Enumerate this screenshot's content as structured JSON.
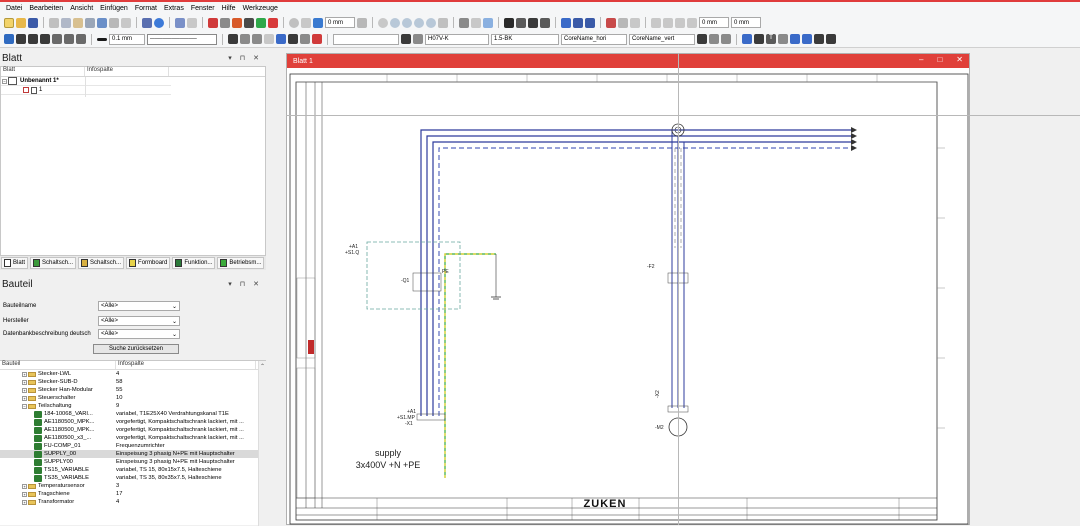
{
  "menu": [
    "Datei",
    "Bearbeiten",
    "Ansicht",
    "Einfügen",
    "Format",
    "Extras",
    "Fenster",
    "Hilfe",
    "Werkzeuge"
  ],
  "toolbar1": {
    "dim1": "0 mm",
    "dim2": "0 mm",
    "dim3": "0 mm"
  },
  "toolbar2": {
    "linewidth": "0.1 mm",
    "wire_type": "H07V-K",
    "wire_cross": "1.5-BK",
    "core_hori": "CoreName_hori",
    "core_vert": "CoreName_vert"
  },
  "blatt_panel": {
    "title": "Blatt",
    "col1": "Blatt",
    "col2": "Infospalte",
    "project": "Unbenannt 1*",
    "sheet": "1"
  },
  "bottom_tabs": [
    "Blatt",
    "Schaltsch...",
    "Schaltsch...",
    "Formboard",
    "Funktion...",
    "Betriebsm..."
  ],
  "bauteil_panel": {
    "title": "Bauteil",
    "fields": [
      {
        "label": "Bauteilname",
        "value": "<Alle>"
      },
      {
        "label": "Hersteller",
        "value": "<Alle>"
      },
      {
        "label": "Datenbankbeschreibung deutsch",
        "value": "<Alle>"
      }
    ],
    "reset_label": "Suche zurücksetzen",
    "col1": "Bauteil",
    "col2": "Infospalte",
    "rows": [
      {
        "name": "Stecker-LWL",
        "info": "4",
        "kind": "folder",
        "exp": "+"
      },
      {
        "name": "Stecker-SUB-D",
        "info": "58",
        "kind": "folder",
        "exp": "+"
      },
      {
        "name": "Stecker Han-Modular",
        "info": "55",
        "kind": "folder",
        "exp": "+"
      },
      {
        "name": "Steuerschalter",
        "info": "10",
        "kind": "folder",
        "exp": "+"
      },
      {
        "name": "Teilschaltung",
        "info": "9",
        "kind": "folder",
        "exp": "-"
      },
      {
        "name": "184-10068_VARI...",
        "info": "variabel, T1E25X40 Verdrahtungskanal T1E",
        "kind": "comp",
        "exp": ""
      },
      {
        "name": "AE1180500_MPK...",
        "info": "vorgefertigt, Kompaktschaltschrank lackiert, mit ...",
        "kind": "comp",
        "exp": ""
      },
      {
        "name": "AE1180500_MPK...",
        "info": "vorgefertigt, Kompaktschaltschrank lackiert, mit ...",
        "kind": "comp",
        "exp": ""
      },
      {
        "name": "AE1180500_x3_...",
        "info": "vorgefertigt, Kompaktschaltschrank lackiert, mit ...",
        "kind": "comp",
        "exp": ""
      },
      {
        "name": "FU-COMP_01",
        "info": "Frequenzumrichter",
        "kind": "comp",
        "exp": ""
      },
      {
        "name": "SUPPLY_00",
        "info": "Einspeisung 3 phasig N+PE mit Hauptschalter",
        "kind": "comp",
        "exp": "",
        "selected": true
      },
      {
        "name": "SUPPLY00",
        "info": "Einspeisung 3 phasig N+PE mit Hauptschalter",
        "kind": "comp",
        "exp": ""
      },
      {
        "name": "TS15_VARIABLE",
        "info": "variabel, TS 15, 80x15x7.5, Halteschiene",
        "kind": "comp",
        "exp": ""
      },
      {
        "name": "TS35_VARIABLE",
        "info": "variabel, TS 35, 80x35x7.5, Halteschiene",
        "kind": "comp",
        "exp": ""
      },
      {
        "name": "Temperatursensor",
        "info": "3",
        "kind": "folder",
        "exp": "+"
      },
      {
        "name": "Tragschiene",
        "info": "17",
        "kind": "folder",
        "exp": "+"
      },
      {
        "name": "Transformator",
        "info": "4",
        "kind": "folder",
        "exp": "+"
      }
    ]
  },
  "document": {
    "title": "Blatt 1",
    "labels": {
      "a1_top": "+A1",
      "s1_top": "+S1.Q",
      "q1": "-Q1",
      "pe": "PE",
      "f2": "-F2",
      "a1_bot": "+A1",
      "s1_bot": "+S1.MP",
      "x1": "-X1",
      "m1": "-M2",
      "x2": "-X2",
      "supply1": "supply",
      "supply2": "3x400V +N +PE",
      "logo": "ZUKEN"
    }
  },
  "colors": {
    "accent_red": "#e0403a",
    "wire_blue": "#2d3b9c",
    "wire_dashed": "#5b6bc0",
    "pe_green": "#3aaa3a",
    "pe_yellow": "#e6d22a",
    "dashed_box": "#6aa8a0"
  }
}
